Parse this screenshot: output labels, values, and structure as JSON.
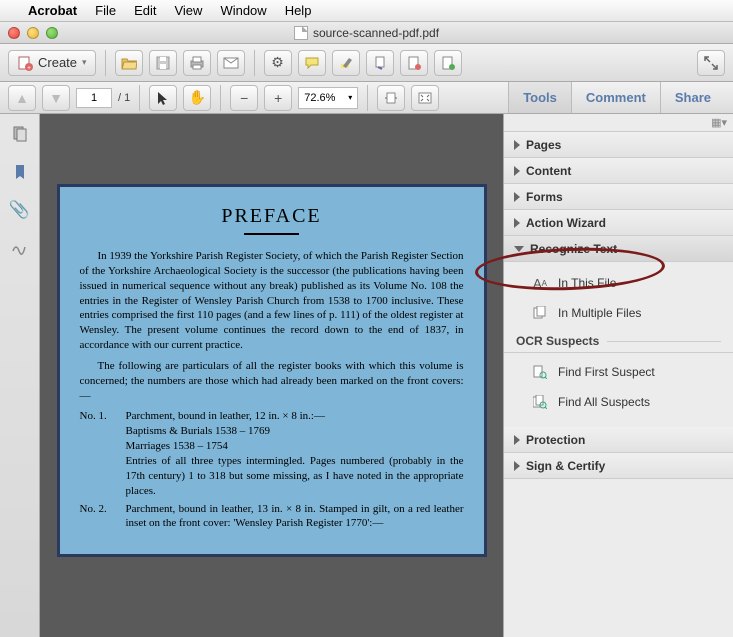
{
  "menubar": {
    "app": "Acrobat",
    "items": [
      "File",
      "Edit",
      "View",
      "Window",
      "Help"
    ]
  },
  "window": {
    "title": "source-scanned-pdf.pdf"
  },
  "toolbar": {
    "create": "Create"
  },
  "nav": {
    "page": "1",
    "total": "1",
    "zoom": "72.6%"
  },
  "rightlinks": {
    "tools": "Tools",
    "comment": "Comment",
    "share": "Share"
  },
  "accordion": {
    "pages": "Pages",
    "content": "Content",
    "forms": "Forms",
    "action": "Action Wizard",
    "recognize": "Recognize Text",
    "protection": "Protection",
    "sign": "Sign & Certify"
  },
  "recognize_sub": {
    "in_this_file": "In This File",
    "in_multiple": "In Multiple Files",
    "suspects_header": "OCR Suspects",
    "find_first": "Find First Suspect",
    "find_all": "Find All Suspects"
  },
  "document": {
    "title": "PREFACE",
    "p1": "In 1939 the Yorkshire Parish Register Society, of which the Parish Register Section of the Yorkshire Archaeological Society is the successor (the publications having been issued in numerical sequence without any break) published as its Volume No. 108 the entries in the Register of Wensley Parish Church from 1538 to 1700 inclusive. These entries comprised the first 110 pages (and a few lines of p. 111) of the oldest register at Wensley. The present volume continues the record down to the end of 1837, in accordance with our current practice.",
    "p2": "The following are particulars of all the register books with which this volume is concerned; the numbers are those which had already been marked on the front covers:—",
    "no1_label": "No. 1.",
    "no1_body": "Parchment, bound in leather, 12 in. × 8 in.:—\nBaptisms & Burials 1538 – 1769\nMarriages              1538 – 1754\nEntries of all three types intermingled. Pages numbered (probably in the 17th century) 1 to 318 but some missing, as I have noted in the appropriate places.",
    "no2_label": "No. 2.",
    "no2_body": "Parchment, bound in leather, 13 in. × 8 in. Stamped in gilt, on a red leather inset on the front cover: 'Wensley Parish Register 1770':—"
  }
}
